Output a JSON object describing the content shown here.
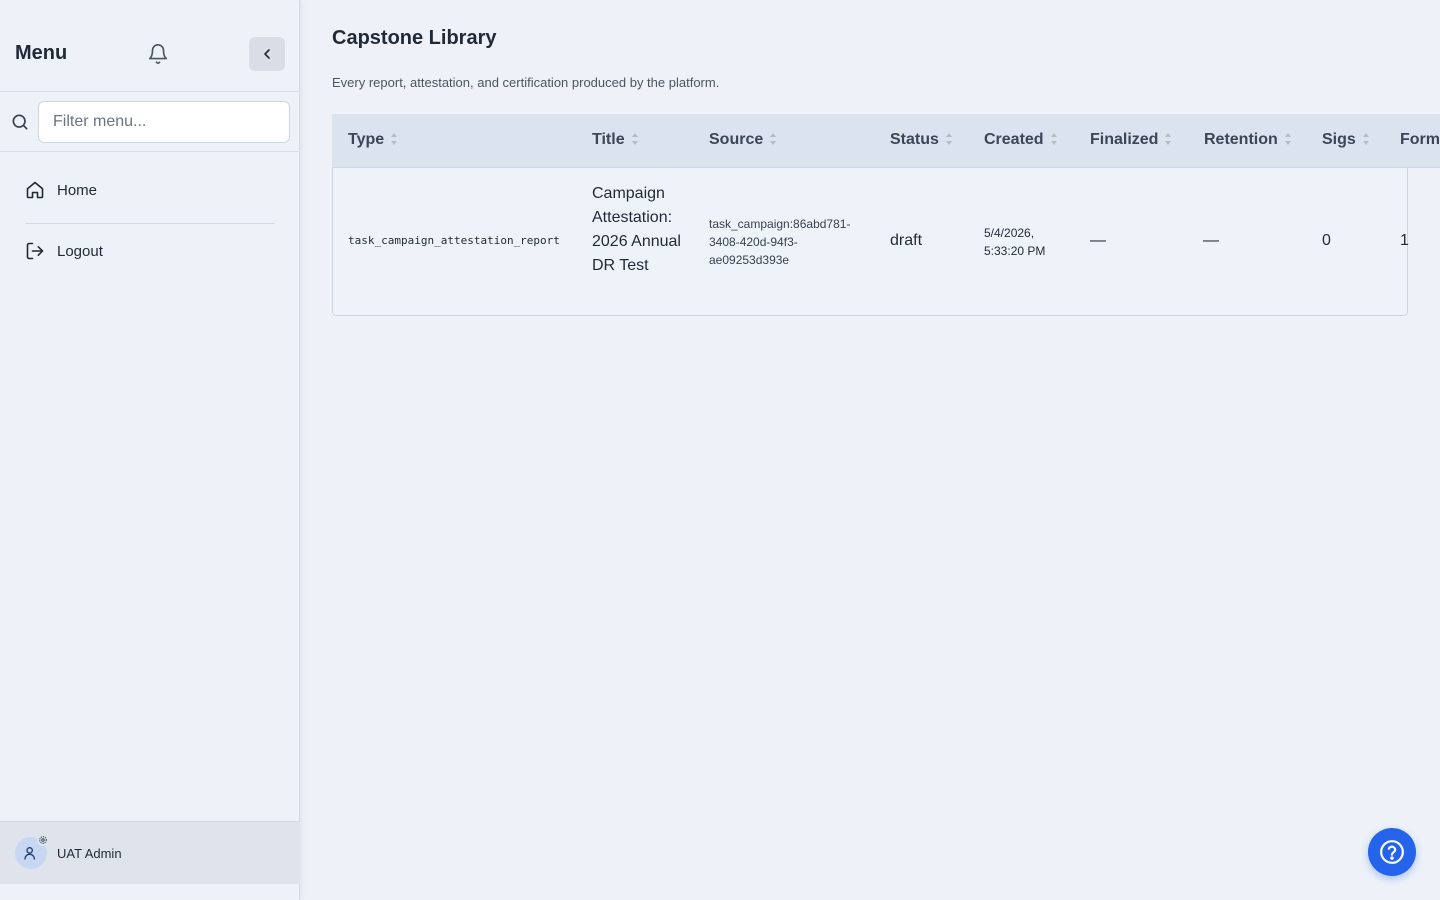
{
  "sidebar": {
    "title": "Menu",
    "search_placeholder": "Filter menu...",
    "items": [
      {
        "label": "Home",
        "icon": "home-icon"
      },
      {
        "label": "Logout",
        "icon": "logout-icon"
      }
    ],
    "user": {
      "name": "UAT Admin"
    }
  },
  "main": {
    "title": "Capstone Library",
    "subtitle": "Every report, attestation, and certification produced by the platform.",
    "table": {
      "columns": [
        "Type",
        "Title",
        "Source",
        "Status",
        "Created",
        "Finalized",
        "Retention",
        "Sigs",
        "Form"
      ],
      "rows": [
        {
          "type": "task_campaign_attestation_report",
          "title": "Campaign Attestation: 2026 Annual DR Test",
          "source": [
            "task_campaign:86abd781-",
            "3408-420d-94f3-",
            "ae09253d393e"
          ],
          "status": "draft",
          "created": [
            "5/4/2026,",
            "5:33:20 PM"
          ],
          "finalized": "—",
          "retention": "—",
          "sigs": "0",
          "format": "1"
        }
      ]
    }
  },
  "colors": {
    "accent": "#2563eb",
    "sidebar_bg": "#edf1f8",
    "page_bg": "#eef2f8",
    "table_header_bg": "#dbe4ee"
  }
}
